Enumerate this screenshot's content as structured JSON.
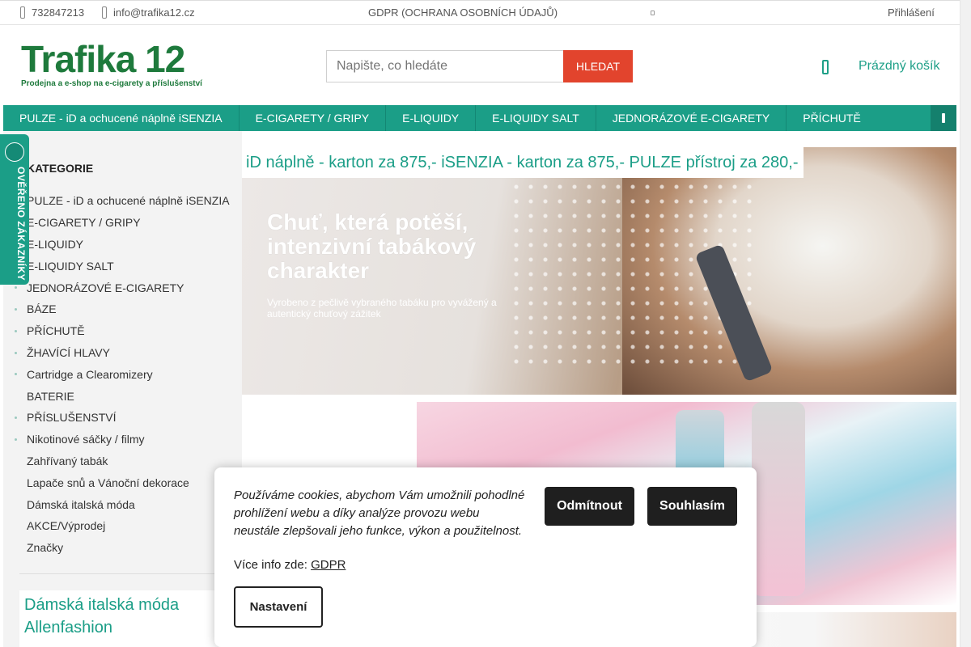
{
  "topbar": {
    "phone": "732847213",
    "email": "info@trafika12.cz",
    "gdpr": "GDPR (OCHRANA OSOBNÍCH ÚDAJŮ)",
    "login": "Přihlášení"
  },
  "logo": {
    "title": "Trafika 12",
    "subtitle": "Prodejna a e-shop na e-cigarety a příslušenství"
  },
  "search": {
    "placeholder": "Napište, co hledáte",
    "button": "HLEDAT"
  },
  "cart": {
    "label": "Prázdný košík"
  },
  "nav": {
    "items": [
      "PULZE - iD a ochucené náplně iSENZIA",
      "E-CIGARETY / GRIPY",
      "E-LIQUIDY",
      "E-LIQUIDY SALT",
      "JEDNORÁZOVÉ E-CIGARETY",
      "PŘÍCHUTĚ"
    ]
  },
  "sidebar": {
    "title": "KATEGORIE",
    "items": [
      "PULZE - iD a ochucené náplně iSENZIA",
      "E-CIGARETY / GRIPY",
      "E-LIQUIDY",
      "E-LIQUIDY SALT",
      "JEDNORÁZOVÉ E-CIGARETY",
      "BÁZE",
      "PŘÍCHUTĚ",
      "ŽHAVÍCÍ HLAVY",
      "Cartridge a Clearomizery",
      "BATERIE",
      "PŘÍSLUŠENSTVÍ",
      "Nikotinové sáčky / filmy",
      "Zahřívaný tabák",
      "Lapače snů a Vánoční dekorace",
      "Dámská italská móda",
      "AKCE/Výprodej",
      "Značky"
    ],
    "promo_title": "Dámská italská móda Allenfashion"
  },
  "badge": {
    "text": "OVĚŘENO ZÁKAZNÍKY"
  },
  "banner": {
    "announcement": "iD náplně - karton za 875,- iSENZIA - karton za 875,- PULZE přístroj za 280,-",
    "headline": "Chuť, která potěší, intenzivní tabákový charakter",
    "subline": "Vyrobeno z pečlivě vybraného tabáku pro vyvážený a autentický chuťový zážitek"
  },
  "cookie": {
    "text": "Používáme cookies, abychom Vám umožnili pohodlné prohlížení webu a díky analýze provozu webu neustále zlepšovali jeho funkce, výkon a použitelnost.",
    "more_prefix": "Více info zde:",
    "more_link": "GDPR",
    "decline": "Odmítnout",
    "accept": "Souhlasím",
    "settings": "Nastavení"
  },
  "colors": {
    "brand_green": "#1e7a3c",
    "nav_teal": "#1b9e87",
    "search_button": "#e2442d"
  }
}
